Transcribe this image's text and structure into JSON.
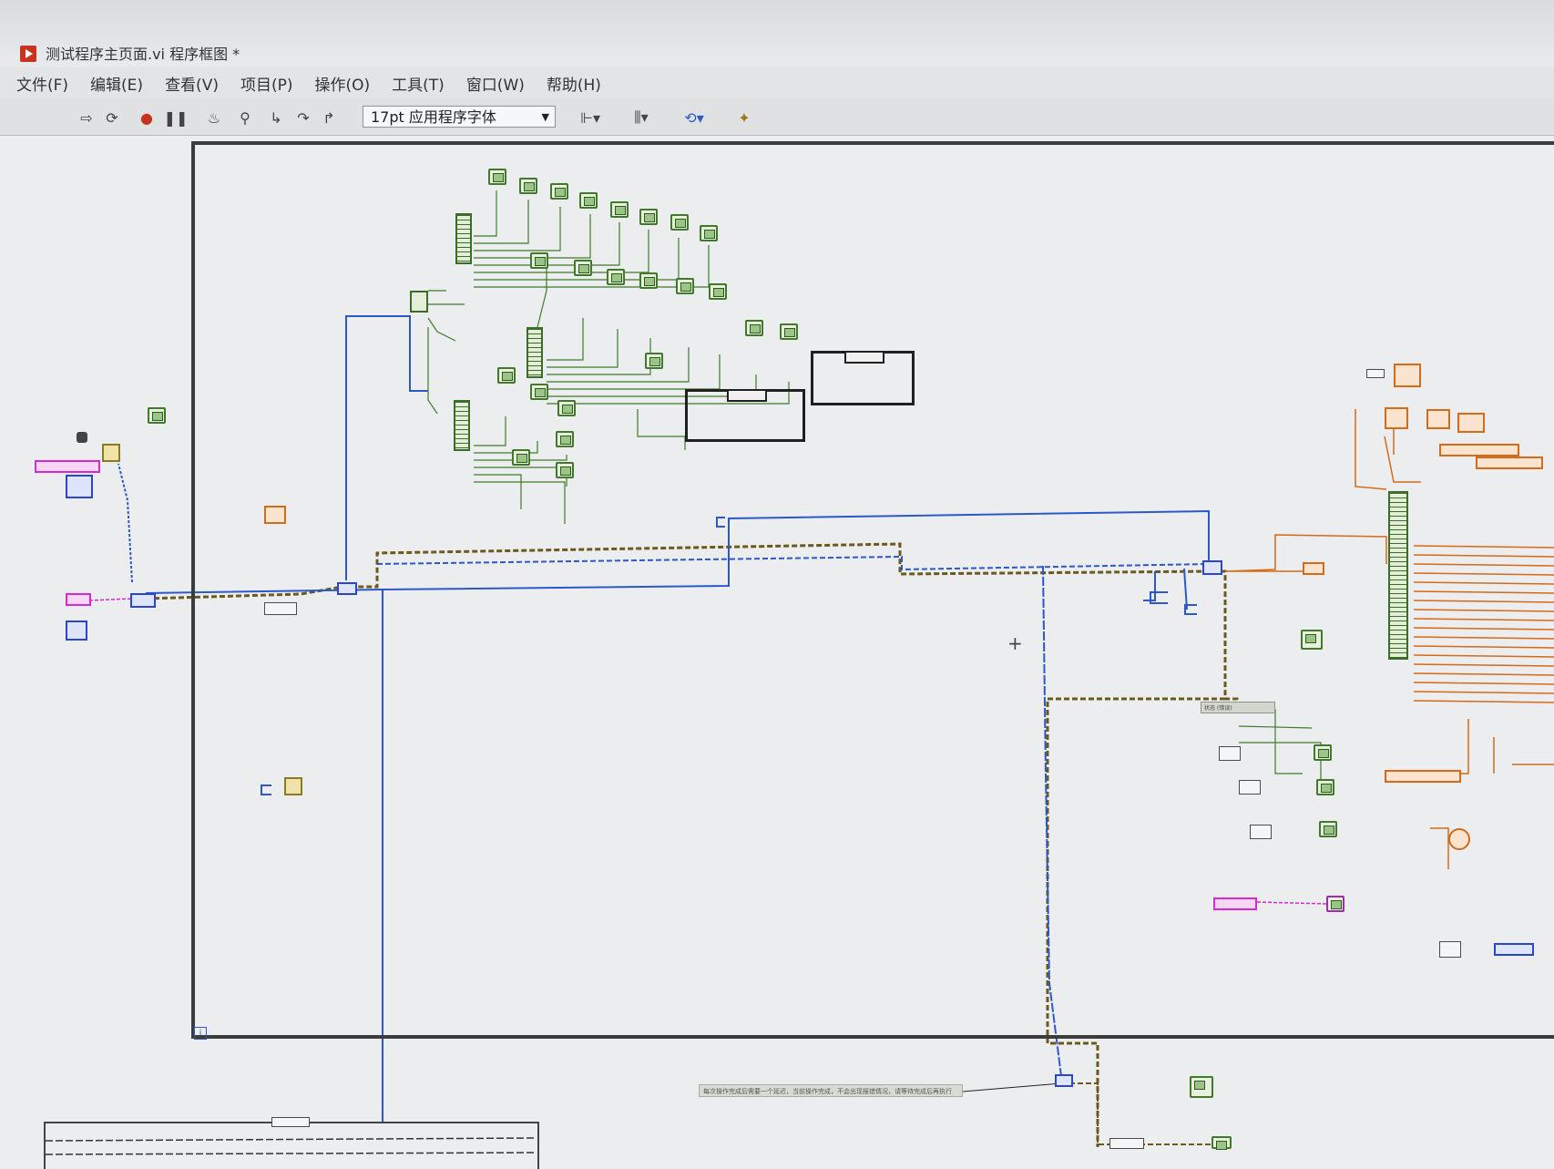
{
  "window": {
    "title": "测试程序主页面.vi 程序框图 *"
  },
  "menu": {
    "items": [
      "文件(F)",
      "编辑(E)",
      "查看(V)",
      "项目(P)",
      "操作(O)",
      "工具(T)",
      "窗口(W)",
      "帮助(H)"
    ]
  },
  "toolbar": {
    "font_selector": "17pt 应用程序字体",
    "icons": [
      "run-arrow-icon",
      "run-continuously-icon",
      "abort-icon",
      "pause-icon",
      "highlight-execution-icon",
      "retain-wire-values-icon",
      "step-into-icon",
      "step-over-icon",
      "step-out-icon",
      "align-objects-icon",
      "distribute-objects-icon",
      "reorder-icon",
      "cleanup-diagram-icon"
    ]
  },
  "diagram": {
    "loop_iteration_label": "i",
    "status_label": "状态 (错误)",
    "comment": "每次操作完成后需要一个延迟，当前操作完成，不会出现报错情况，请等待完成后再执行"
  },
  "colors": {
    "wire_blue": "#2d58c9",
    "wire_green": "#3f7a2a",
    "wire_orange": "#d26b1a",
    "wire_pink": "#d42ad4",
    "wire_error": "#6b5a1e",
    "accent_red": "#c8321e"
  }
}
